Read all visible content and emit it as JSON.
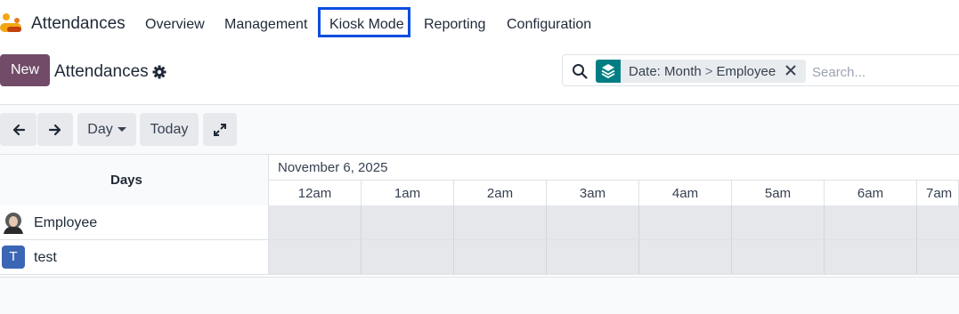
{
  "nav": {
    "app_name": "Attendances",
    "items": [
      "Overview",
      "Management",
      "Kiosk Mode",
      "Reporting",
      "Configuration"
    ]
  },
  "control": {
    "new_label": "New",
    "title": "Attendances",
    "search": {
      "facet_label": "Date: Month",
      "facet_sep": ">",
      "facet_label2": "Employee",
      "placeholder": "Search..."
    }
  },
  "toolbar": {
    "scale_label": "Day",
    "today_label": "Today"
  },
  "gantt": {
    "rows_header": "Days",
    "date_range": "November 6, 2025",
    "hours": [
      "12am",
      "1am",
      "2am",
      "3am",
      "4am",
      "5am",
      "6am",
      "7am"
    ],
    "rows": [
      {
        "name": "Employee",
        "avatar": "photo"
      },
      {
        "name": "test",
        "avatar_letter": "T"
      }
    ]
  },
  "colors": {
    "brand": "#714b67",
    "facet_accent": "#017e84",
    "highlight": "#0b4de0"
  }
}
